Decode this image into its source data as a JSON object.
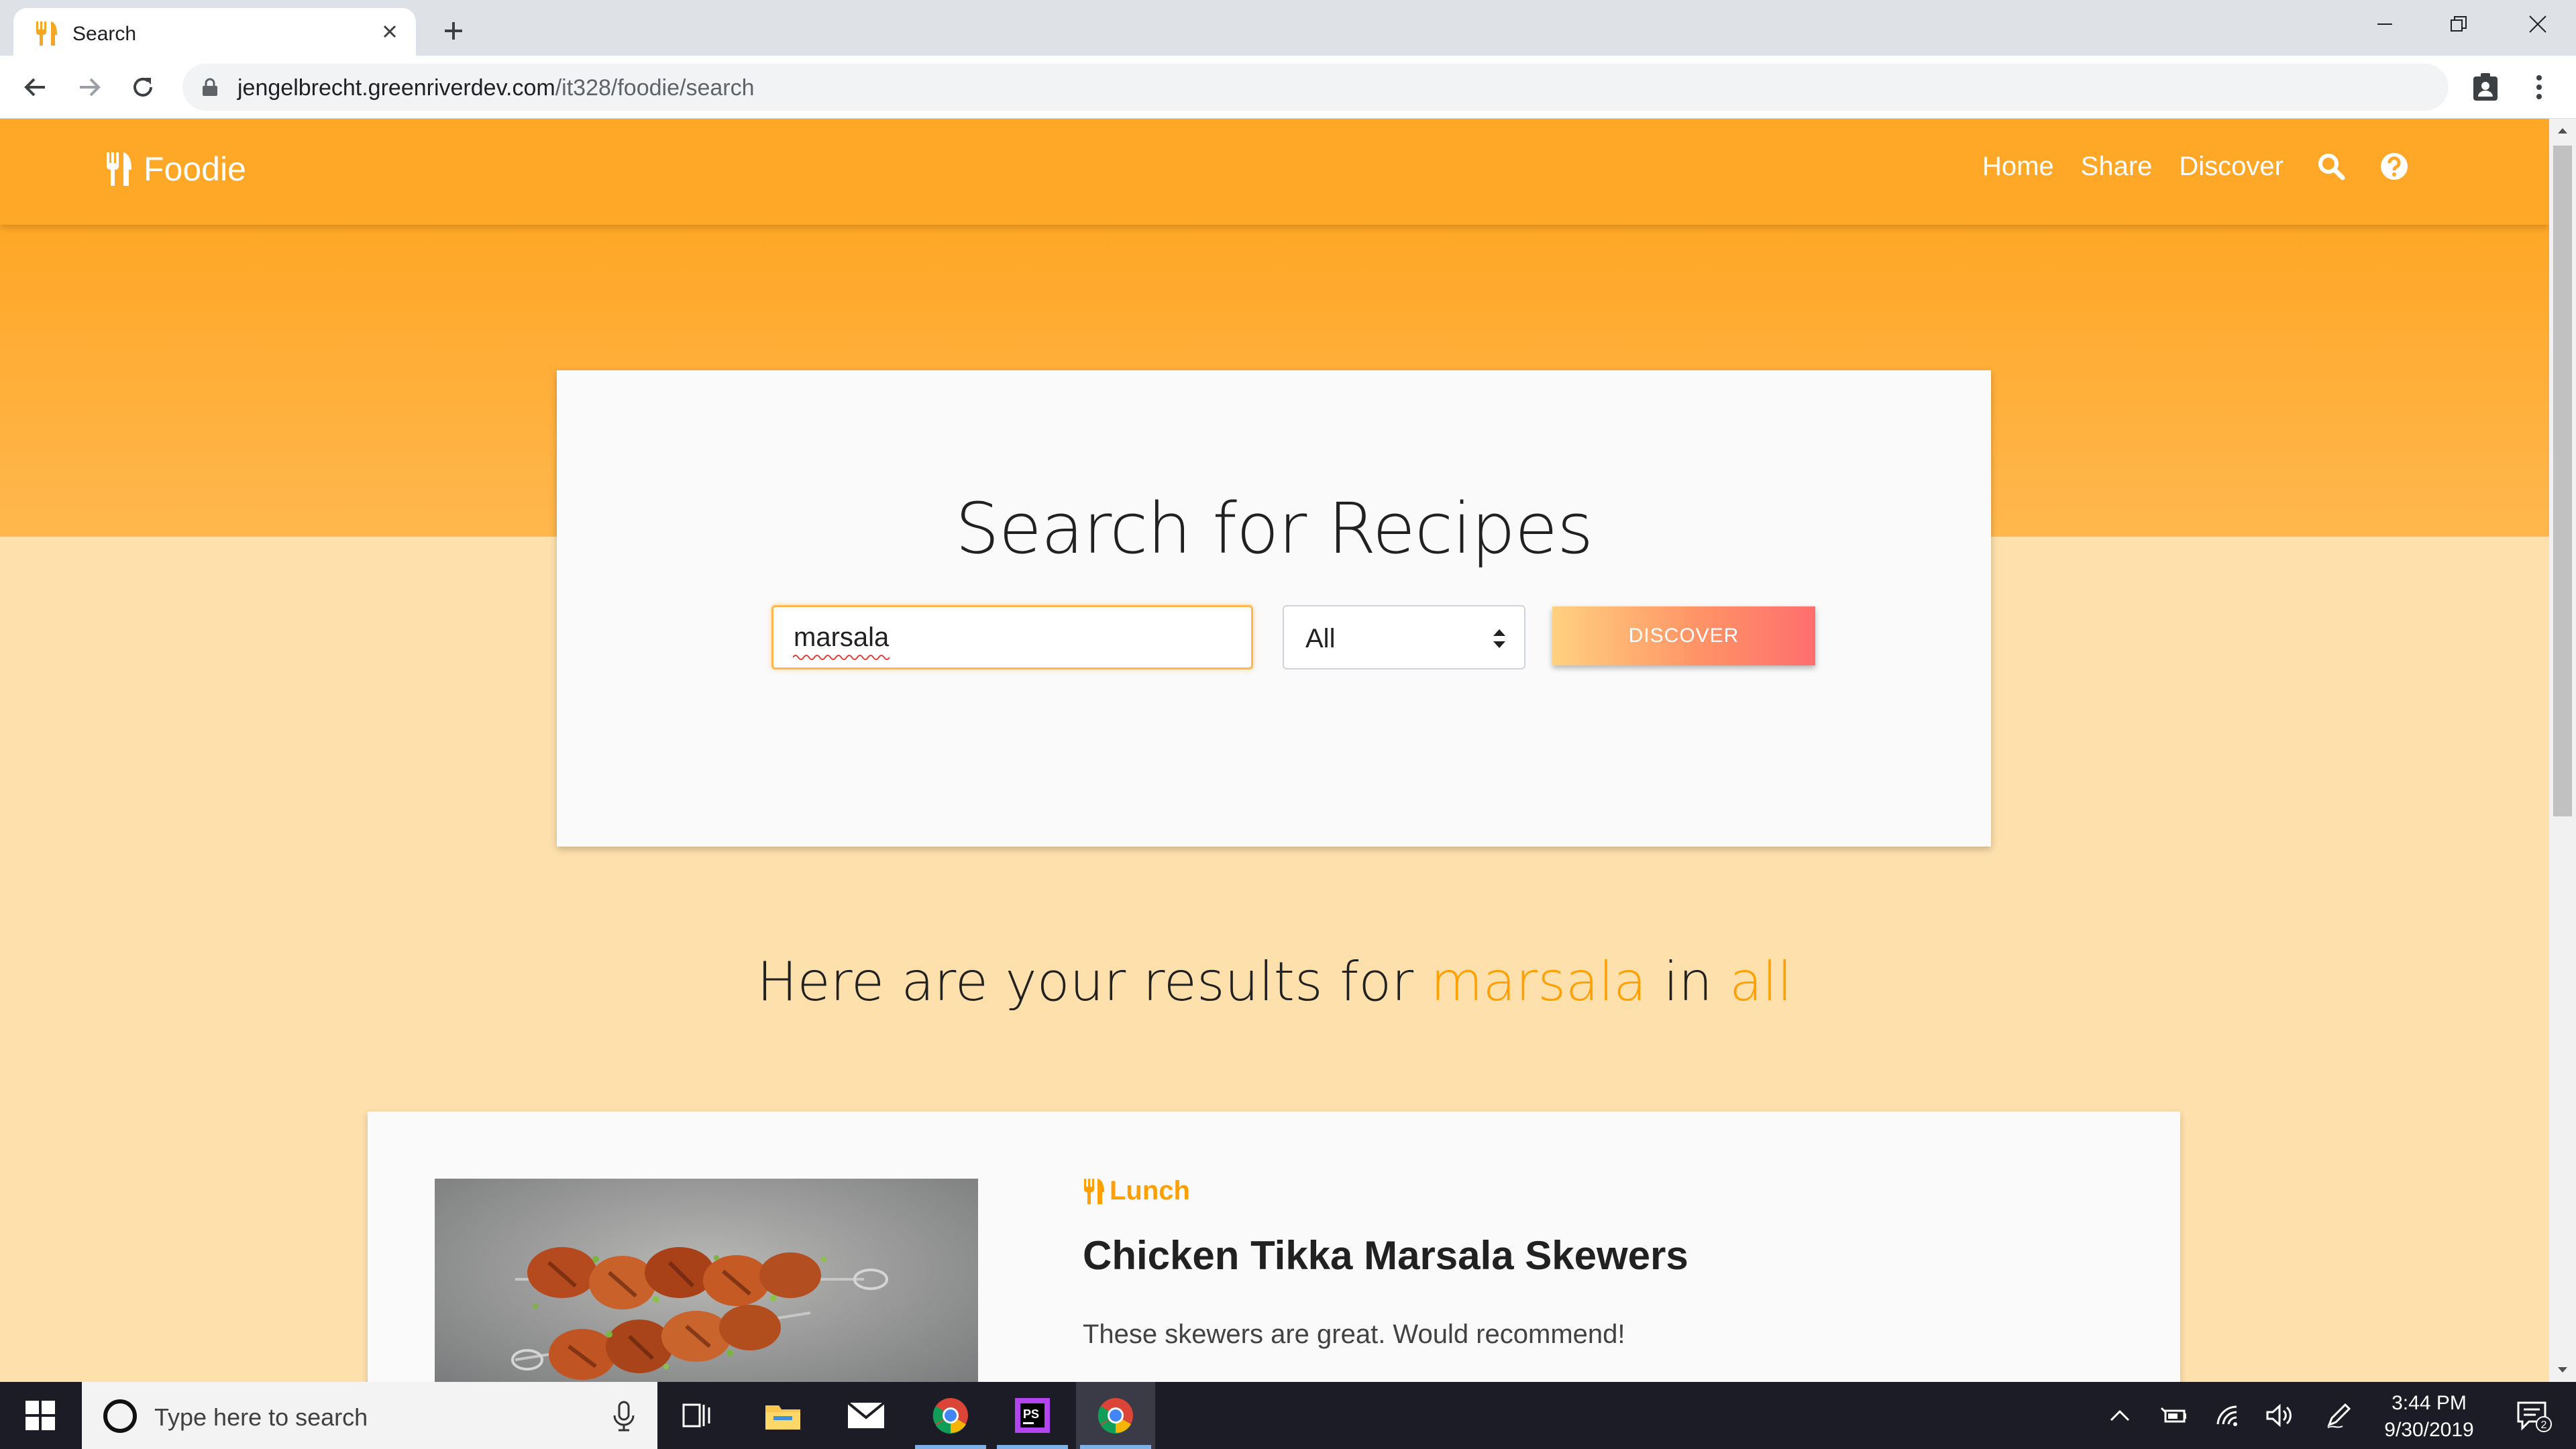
{
  "browser": {
    "tab_title": "Search",
    "url_host": "jengelbrecht.greenriverdev.com",
    "url_path": "/it328/foodie/search"
  },
  "navbar": {
    "brand": "Foodie",
    "links": [
      "Home",
      "Share",
      "Discover"
    ]
  },
  "search": {
    "title": "Search for Recipes",
    "query": "marsala",
    "category": "All",
    "button": "DISCOVER"
  },
  "results": {
    "prefix": "Here are your results for",
    "query": "marsala",
    "middle": "in",
    "category": "all"
  },
  "recipe": {
    "category": "Lunch",
    "title": "Chicken Tikka Marsala Skewers",
    "description": "These skewers are great. Would recommend!"
  },
  "taskbar": {
    "search_placeholder": "Type here to search",
    "time": "3:44 PM",
    "date": "9/30/2019",
    "notification_count": "2"
  },
  "colors": {
    "primary": "#ffa726",
    "accent": "#ffa000",
    "page_bg": "#fee0ad"
  }
}
